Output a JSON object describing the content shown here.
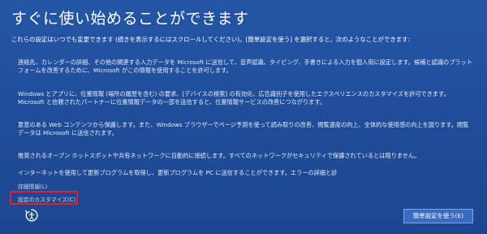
{
  "setup": {
    "title": "すぐに使い始めることができます",
    "intro": "これらの設定はいつでも変更できます (続きを表示するにはスクロールしてください)。[簡単設定を使う] を選択すると、次のようなことができます:",
    "paragraphs": [
      "連絡先、カレンダーの詳細、その他の関連する入力データを Microsoft に送信して、音声認識、タイピング、手書きによる入力を個人用に設定します。候補と認識のプラットフォームを改善するために、Microsoft がこの情報を使用することを許可します。",
      "Windows とアプリに、位置情報 (場所の履歴を含む) の要求、[デバイスの検索] の有効化、広告識別子を使用したエクスペリエンスのカスタマイズを許可できます。Microsoft と信頼されたパートナーに位置情報データの一部を送信すると、位置情報サービスの改善につながります。",
      "悪意のある Web コンテンツから保護します。また、Windows ブラウザーでページ予測を使って読み取りの改善、閲覧速度の向上、全体的な使用感の向上を図ります。閲覧データは Microsoft に送信されます。",
      "推奨されるオープン ホットスポットや共有ネットワークに自動的に接続します。すべてのネットワークがセキュリティで保護されているとは限りません。",
      "インターネットを使用して更新プログラムを取得し、更新プログラムを PC に送信することができます。エラーの詳細と診"
    ],
    "details_link": "詳細情報(L)",
    "customize_link": "設定のカスタマイズ(C)",
    "express_button": "簡単設定を使う(E)"
  },
  "colors": {
    "background": "#1f4e9a",
    "button": "#3a6bc2",
    "highlight": "#e21f2b"
  },
  "icons": {
    "accessibility": "ease-of-access-icon"
  }
}
